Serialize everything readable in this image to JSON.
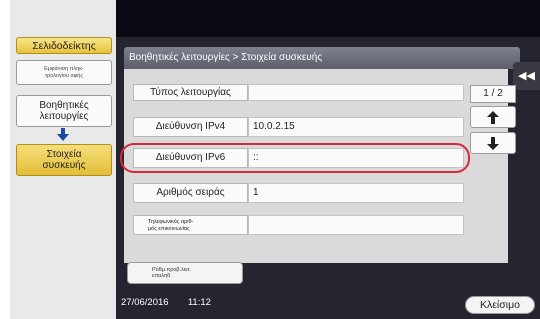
{
  "sidebar": {
    "bookmark_label": "Σελιδοδείκτης",
    "keyboard_label_line1": "Εμφάνιση πληκ-",
    "keyboard_label_line2": "τρολογίου αφής",
    "utility_label_line1": "Βοηθητικές",
    "utility_label_line2": "λειτουργίες",
    "device_info_label_line1": "Στοιχεία",
    "device_info_label_line2": "συσκευής"
  },
  "header": {
    "breadcrumb": "Βοηθητικές λειτουργίες > Στοιχεία συσκευής"
  },
  "rows": [
    {
      "label": "Τύπος λειτουργίας",
      "value": ""
    },
    {
      "label": "Διεύθυνση IPv4",
      "value": "10.0.2.15"
    },
    {
      "label": "Διεύθυνση IPv6",
      "value": "::"
    },
    {
      "label": "Αριθμός σειράς",
      "value": "1"
    },
    {
      "label_line1": "Τηλεφωνικός αριθ-",
      "label_line2": "μός επικοινωνίας",
      "value": ""
    }
  ],
  "pager": {
    "indicator": "1 / 2"
  },
  "footer": {
    "setup_label_line1": "Ρύθμ.προβ.λειτ.",
    "setup_label_line2": "επαληθ.",
    "date": "27/06/2016",
    "time": "11:12",
    "close_label": "Κλείσιμο"
  },
  "colors": {
    "highlight": "#d8283b",
    "accent_yellow": "#e7c23c",
    "panel": "#25252f"
  }
}
